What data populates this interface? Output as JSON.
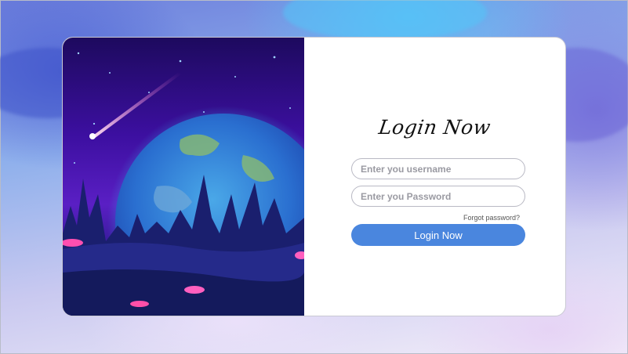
{
  "login": {
    "title": "Login Now",
    "username_placeholder": "Enter you username",
    "password_placeholder": "Enter you Password",
    "forgot_label": "Forgot password?",
    "button_label": "Login Now"
  },
  "colors": {
    "button": "#4a86de",
    "card": "#ffffff",
    "art_sky": "#3c0fa0"
  }
}
